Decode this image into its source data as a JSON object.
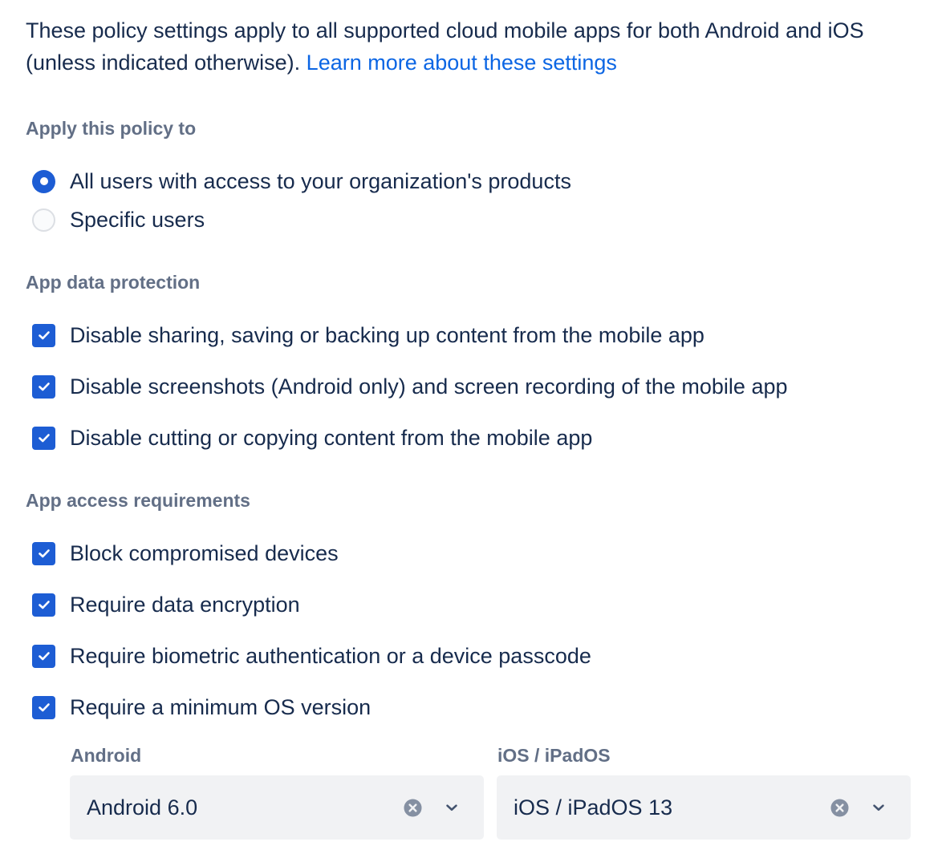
{
  "intro": {
    "text": "These policy settings apply to all supported cloud mobile apps for both Android and iOS (unless indicated otherwise). ",
    "link": "Learn more about these settings"
  },
  "apply_policy": {
    "heading": "Apply this policy to",
    "options": [
      {
        "label": "All users with access to your organization's products",
        "selected": true
      },
      {
        "label": "Specific users",
        "selected": false
      }
    ]
  },
  "data_protection": {
    "heading": "App data protection",
    "items": [
      {
        "label": "Disable sharing, saving or backing up content from the mobile app",
        "checked": true
      },
      {
        "label": "Disable screenshots (Android only) and screen recording of the mobile app",
        "checked": true
      },
      {
        "label": "Disable cutting or copying content from the mobile app",
        "checked": true
      }
    ]
  },
  "access_requirements": {
    "heading": "App access requirements",
    "items": [
      {
        "label": "Block compromised devices",
        "checked": true
      },
      {
        "label": "Require data encryption",
        "checked": true
      },
      {
        "label": "Require biometric authentication or a device passcode",
        "checked": true
      },
      {
        "label": "Require a minimum OS version",
        "checked": true
      }
    ]
  },
  "os_versions": {
    "android": {
      "label": "Android",
      "value": "Android 6.0"
    },
    "ios": {
      "label": "iOS / iPadOS",
      "value": "iOS / iPadOS 13"
    }
  },
  "icons": {
    "checkbox": "check-icon",
    "clear": "clear-icon",
    "dropdown": "chevron-down-icon"
  },
  "colors": {
    "accent": "#1d5dd4",
    "link": "#0c66e4",
    "text": "#172b4d",
    "subtle_text": "#626f86",
    "select_background": "#f1f2f4"
  }
}
